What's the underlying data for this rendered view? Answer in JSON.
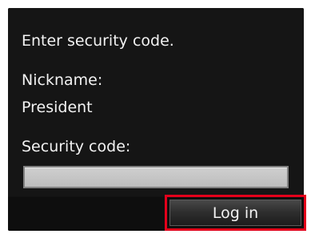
{
  "screen": {
    "instruction": "Enter security code.",
    "nickname_label": "Nickname:",
    "nickname_value": "President",
    "security_code_label": "Security code:",
    "security_code_value": ""
  },
  "actions": {
    "login_label": "Log in"
  },
  "colors": {
    "screen_background": "#151515",
    "highlight_border": "#e3001b"
  }
}
